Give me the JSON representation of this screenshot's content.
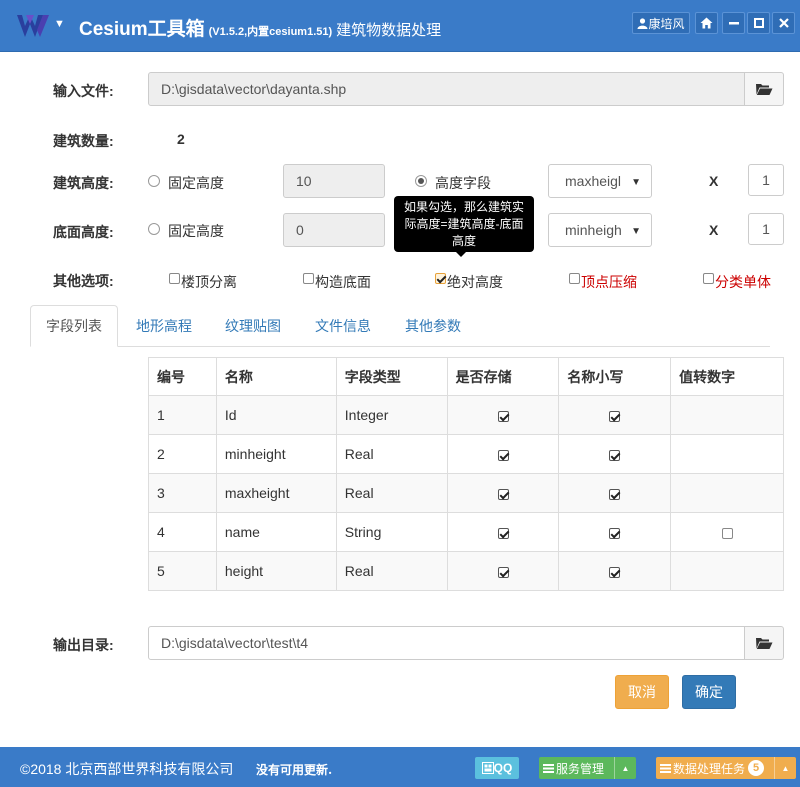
{
  "app": {
    "title": "Cesium工具箱",
    "version": "(V1.5.2,内置cesium1.51)",
    "subtitle": "建筑物数据处理",
    "user": "康培风",
    "brand_color": "#3a7bc8"
  },
  "form": {
    "input_label": "输入文件:",
    "input_value": "D:\\gisdata\\vector\\dayanta.shp",
    "count_label": "建筑数量:",
    "count_value": "2",
    "height_label": "建筑高度:",
    "height_fixed_label": "固定高度",
    "height_fixed_value": "10",
    "height_field_label": "高度字段",
    "height_field_value": "maxheigl",
    "height_mul": "X",
    "height_factor": "1",
    "base_label": "底面高度:",
    "base_fixed_label": "固定高度",
    "base_fixed_value": "0",
    "base_field_value": "minheigh",
    "base_mul": "X",
    "base_factor": "1",
    "other_label": "其他选项:",
    "options": [
      {
        "label": "楼顶分离",
        "checked": false
      },
      {
        "label": "构造底面",
        "checked": false
      },
      {
        "label": "绝对高度",
        "checked": true
      },
      {
        "label": "顶点压缩",
        "checked": false
      },
      {
        "label": "分类单体",
        "checked": false
      }
    ],
    "tooltip": "如果勾选，那么建筑实际高度=建筑高度-底面高度",
    "output_label": "输出目录:",
    "output_value": "D:\\gisdata\\vector\\test\\t4"
  },
  "tabs": [
    "字段列表",
    "地形高程",
    "纹理贴图",
    "文件信息",
    "其他参数"
  ],
  "table": {
    "headers": [
      "编号",
      "名称",
      "字段类型",
      "是否存储",
      "名称小写",
      "值转数字"
    ],
    "rows": [
      {
        "no": "1",
        "name": "Id",
        "type": "Integer",
        "store": true,
        "lower": true,
        "tonum": null
      },
      {
        "no": "2",
        "name": "minheight",
        "type": "Real",
        "store": true,
        "lower": true,
        "tonum": null
      },
      {
        "no": "3",
        "name": "maxheight",
        "type": "Real",
        "store": true,
        "lower": true,
        "tonum": null
      },
      {
        "no": "4",
        "name": "name",
        "type": "String",
        "store": true,
        "lower": true,
        "tonum": false
      },
      {
        "no": "5",
        "name": "height",
        "type": "Real",
        "store": true,
        "lower": true,
        "tonum": null
      }
    ]
  },
  "buttons": {
    "cancel": "取消",
    "ok": "确定"
  },
  "status": {
    "copyright": "©2018 北京西部世界科技有限公司",
    "update": "没有可用更新.",
    "qq": "QQ",
    "service": "服务管理",
    "tasks": "数据处理任务",
    "task_count": "5"
  }
}
